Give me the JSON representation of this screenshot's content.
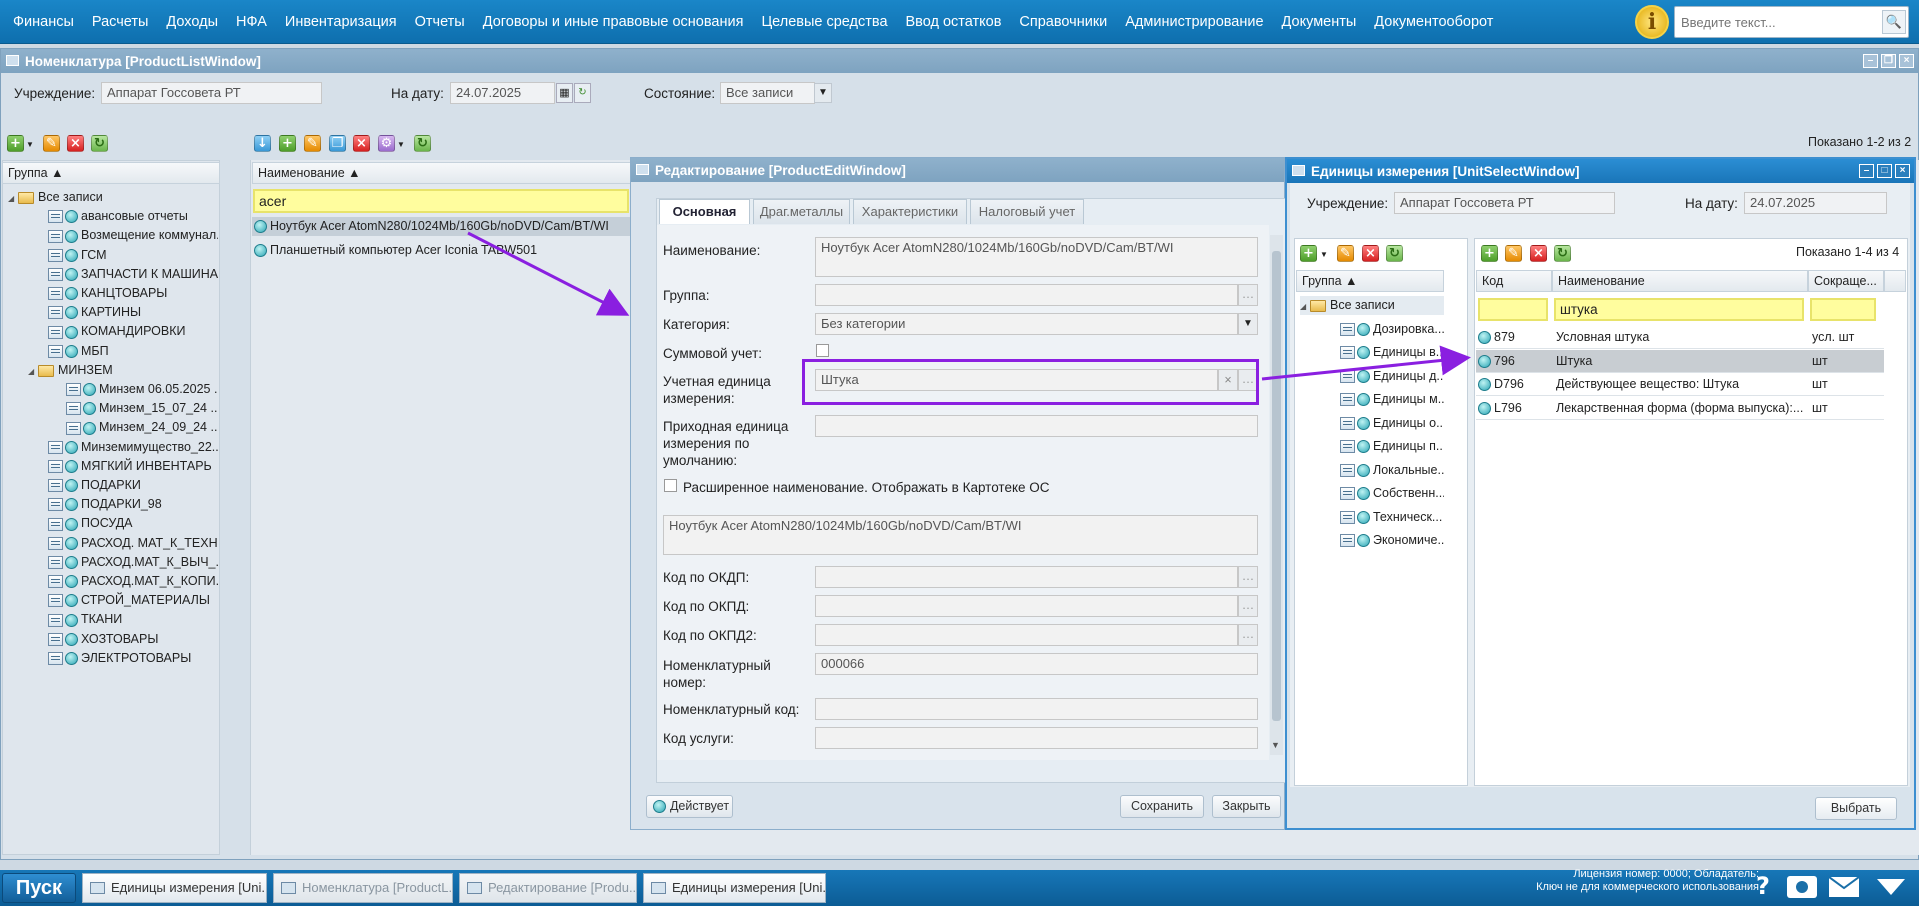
{
  "menu": [
    "Финансы",
    "Расчеты",
    "Доходы",
    "НФА",
    "Инвентаризация",
    "Отчеты",
    "Договоры и иные правовые основания",
    "Целевые средства",
    "Ввод остатков",
    "Справочники",
    "Администрирование",
    "Документы",
    "Документооборот"
  ],
  "top_search": {
    "placeholder": "Введите текст..."
  },
  "product_list": {
    "title": "Номенклатура [ProductListWindow]",
    "institution_label": "Учреждение:",
    "institution_value": "Аппарат Госсовета РТ",
    "date_label": "На дату:",
    "date_value": "24.07.2025",
    "state_label": "Состояние:",
    "state_value": "Все записи",
    "shown": "Показано 1-2 из 2",
    "group_header": "Группа",
    "name_header": "Наименование",
    "filter_value": "acer",
    "tree": {
      "root": "Все записи",
      "items": [
        "авансовые отчеты",
        "Возмещение коммунал...",
        "ГСМ",
        "ЗАПЧАСТИ К МАШИНА...",
        "КАНЦТОВАРЫ",
        "КАРТИНЫ",
        "КОМАНДИРОВКИ",
        "МБП",
        "МИНЗЕМ"
      ],
      "minzem_children": [
        "Минзем 06.05.2025 ...",
        "Минзем_15_07_24 ...",
        "Минзем_24_09_24 ..."
      ],
      "items2": [
        "Минземимущество_22...",
        "МЯГКИЙ ИНВЕНТАРЬ",
        "ПОДАРКИ",
        "ПОДАРКИ_98",
        "ПОСУДА",
        "РАСХОД. МАТ_К_ТЕХН",
        "РАСХОД.МАТ_К_ВЫЧ_...",
        "РАСХОД.МАТ_К_КОПИ...",
        "СТРОЙ_МАТЕРИАЛЫ",
        "ТКАНИ",
        "ХОЗТОВАРЫ",
        "ЭЛЕКТРОТОВАРЫ"
      ]
    },
    "rows": [
      "Ноутбук Acer AtomN280/1024Mb/160Gb/noDVD/Cam/BT/WI",
      "Планшетный компьютер Acer Iconia TABW501"
    ]
  },
  "edit": {
    "title": "Редактирование [ProductEditWindow]",
    "tabs": [
      "Основная",
      "Драг.металлы",
      "Характеристики",
      "Налоговый учет"
    ],
    "name_label": "Наименование:",
    "name_value": "Ноутбук  Acer  AtomN280/1024Mb/160Gb/noDVD/Cam/BT/WI",
    "group_label": "Группа:",
    "category_label": "Категория:",
    "category_value": "Без категории",
    "sum_label": "Суммовой учет:",
    "unit_label": "Учетная единица измерения:",
    "unit_value": "Штука",
    "in_unit_label": "Приходная единица измерения по умолчанию:",
    "ext_label": "Расширенное наименование. Отображать в Картотеке ОС",
    "ext_value": "Ноутбук  Acer  AtomN280/1024Mb/160Gb/noDVD/Cam/BT/WI",
    "okdp_label": "Код по ОКДП:",
    "okpd_label": "Код по ОКПД:",
    "okpd2_label": "Код по ОКПД2:",
    "nomnum_label": "Номенклатурный номер:",
    "nomnum_value": "000066",
    "nomcode_label": "Номенклатурный код:",
    "service_label": "Код услуги:",
    "status": "Действует",
    "save": "Сохранить",
    "close": "Закрыть"
  },
  "unit_select": {
    "title": "Единицы измерения [UnitSelectWindow]",
    "institution_label": "Учреждение:",
    "institution_value": "Аппарат Госсовета РТ",
    "date_label": "На дату:",
    "date_value": "24.07.2025",
    "shown": "Показано 1-4 из 4",
    "group_header": "Группа",
    "tree_root": "Все записи",
    "tree": [
      "Дозировка...",
      "Единицы в...",
      "Единицы д...",
      "Единицы м...",
      "Единицы о...",
      "Единицы п...",
      "Локальные...",
      "Собственн...",
      "Техническ...",
      "Экономиче..."
    ],
    "headers": {
      "code": "Код",
      "name": "Наименование",
      "short": "Сокраще..."
    },
    "filter_name": "штука",
    "rows": [
      {
        "code": "879",
        "name": "Условная штука",
        "short": "усл. шт"
      },
      {
        "code": "796",
        "name": "Штука",
        "short": "шт"
      },
      {
        "code": "D796",
        "name": "Действующее вещество: Штука",
        "short": "шт"
      },
      {
        "code": "L796",
        "name": "Лекарственная форма (форма выпуска):...",
        "short": "шт"
      }
    ],
    "select": "Выбрать"
  },
  "taskbar": {
    "start": "Пуск",
    "tasks": [
      "Единицы измерения [Uni...",
      "Номенклатура [ProductL...",
      "Редактирование [Produ...",
      "Единицы измерения [Uni..."
    ],
    "license1": "Лицензия номер: 0000; Обладатель:",
    "license2": "Ключ не для коммерческого использования"
  },
  "colors": {
    "accent": "#1a86c8",
    "annotation": "#8a1fe0",
    "highlight_field": "#fffd9e"
  }
}
